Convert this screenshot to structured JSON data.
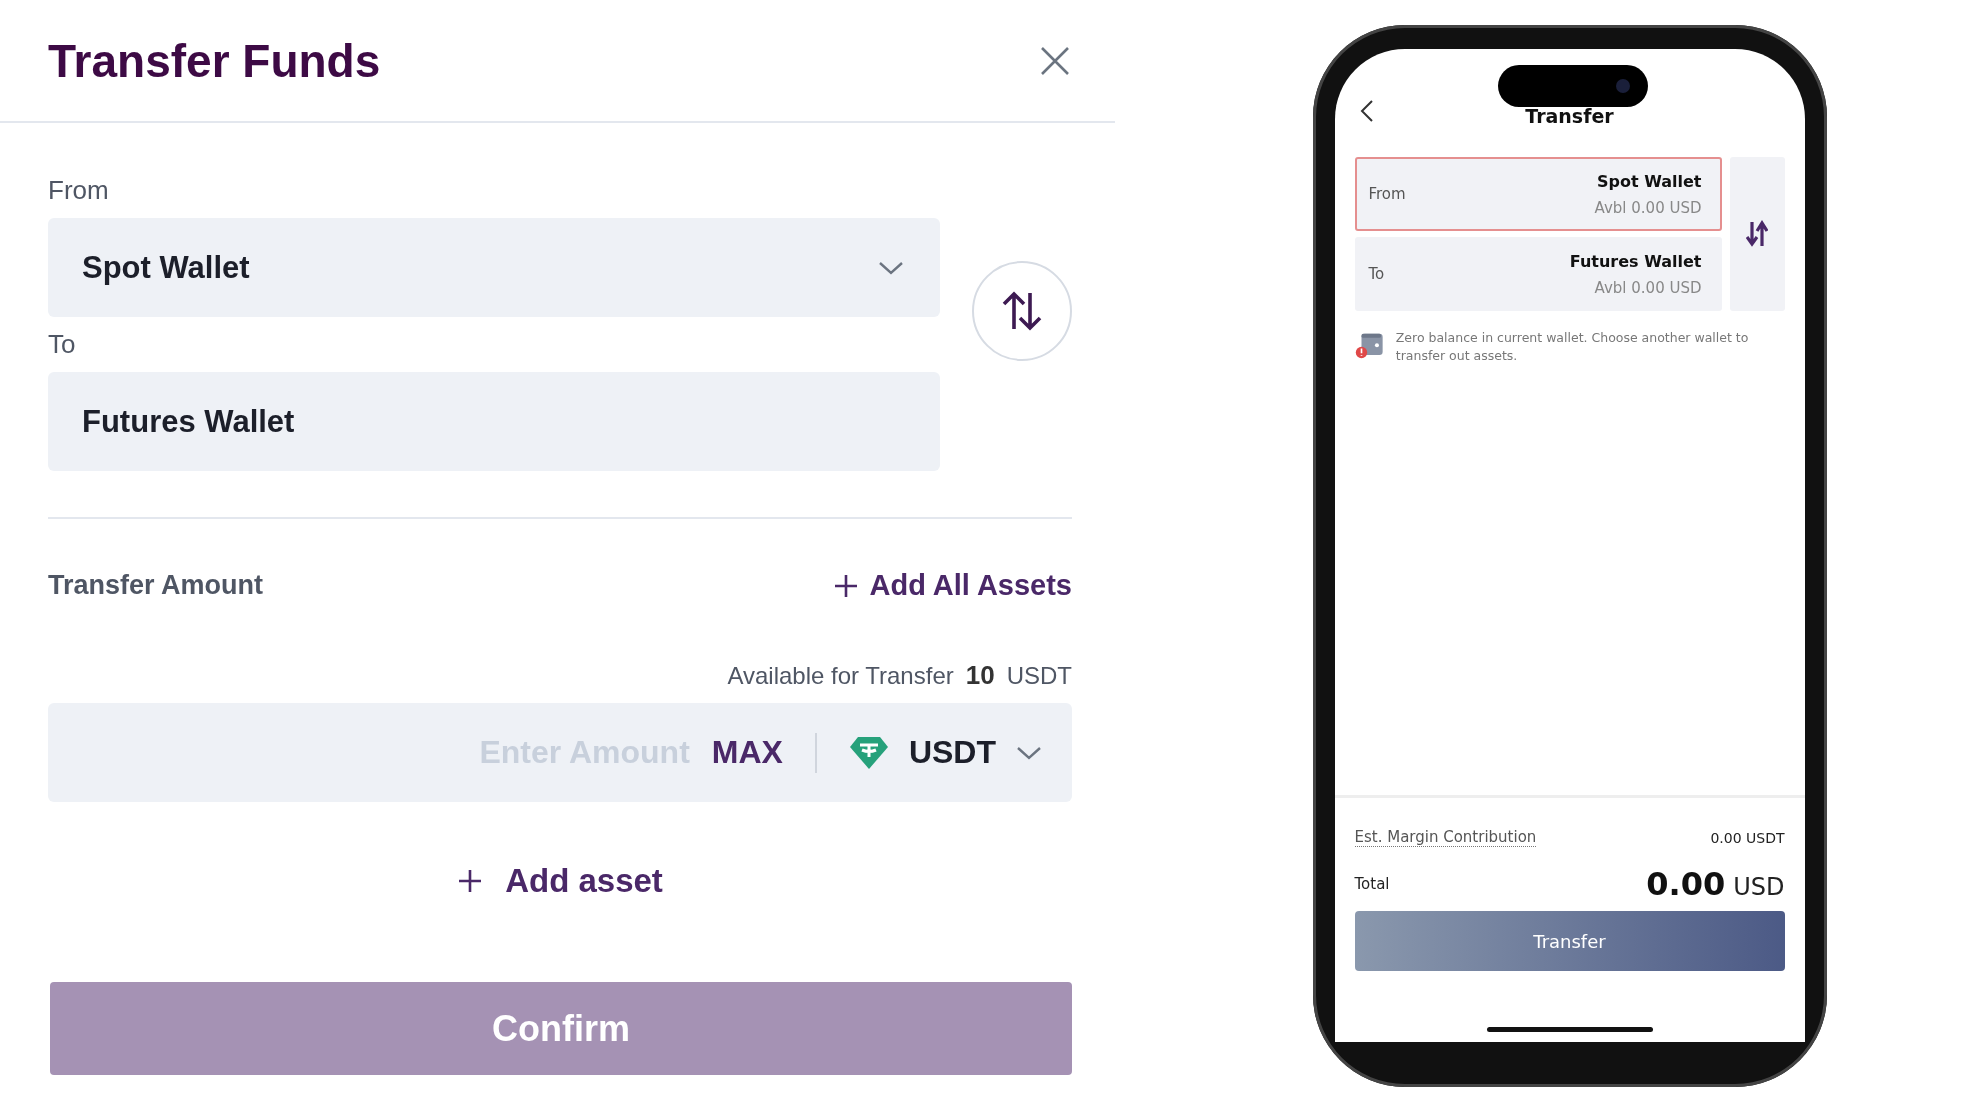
{
  "dialog": {
    "title": "Transfer Funds",
    "from": {
      "label": "From",
      "value": "Spot Wallet"
    },
    "to": {
      "label": "To",
      "value": "Futures Wallet"
    },
    "amount_label": "Transfer Amount",
    "add_all": "Add All Assets",
    "available": {
      "label": "Available for Transfer",
      "value": "10",
      "unit": "USDT"
    },
    "amount_field": {
      "placeholder": "Enter Amount",
      "max": "MAX",
      "asset": "USDT"
    },
    "add_asset": "Add asset",
    "confirm": {
      "label": "Confirm",
      "disabled": true
    }
  },
  "phone": {
    "title": "Transfer",
    "wallets": [
      {
        "label": "From",
        "name": "Spot Wallet",
        "balance": "Avbl 0.00 USD",
        "highlighted": true
      },
      {
        "label": "To",
        "name": "Futures Wallet",
        "balance": "Avbl 0.00 USD",
        "highlighted": false
      }
    ],
    "warning": "Zero balance in current wallet. Choose another wallet to transfer out assets.",
    "est_label": "Est. Margin Contribution",
    "est_value": "0.00 USDT",
    "total_label": "Total",
    "total_value": "0.00",
    "total_unit": "USD",
    "button": "Transfer"
  }
}
